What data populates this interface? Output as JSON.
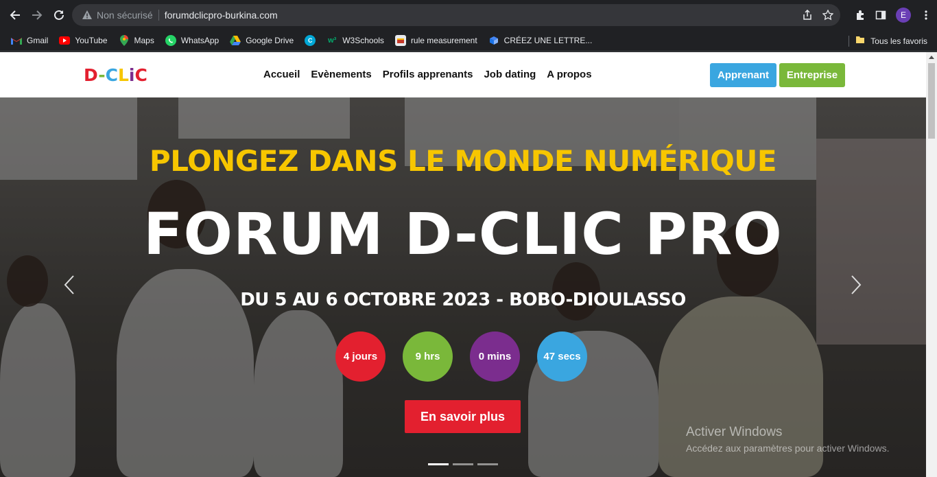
{
  "browser": {
    "security_label": "Non sécurisé",
    "url": "forumdclicpro-burkina.com",
    "profile_initial": "E"
  },
  "bookmarks": {
    "items": [
      {
        "label": "Gmail",
        "icon": "gmail-icon",
        "color": "#ea4335"
      },
      {
        "label": "YouTube",
        "icon": "youtube-icon",
        "color": "#ff0000"
      },
      {
        "label": "Maps",
        "icon": "maps-icon",
        "color": "#34a853"
      },
      {
        "label": "WhatsApp",
        "icon": "whatsapp-icon",
        "color": "#25d366"
      },
      {
        "label": "Google Drive",
        "icon": "google-drive-icon",
        "color": "#fbbc04"
      },
      {
        "label": "",
        "icon": "canva-icon",
        "color": "#00c4cc"
      },
      {
        "label": "W3Schools",
        "icon": "w3schools-icon",
        "color": "#04aa6d"
      },
      {
        "label": "rule measurement",
        "icon": "rule-measurement-icon",
        "color": "#e8eaed"
      },
      {
        "label": "CRÉEZ UNE LETTRE...",
        "icon": "letter-icon",
        "color": "#4285f4"
      }
    ],
    "all_favorites": "Tous les favoris"
  },
  "site": {
    "logo_letters": [
      "D",
      "-",
      "C",
      "L",
      "i",
      "C"
    ],
    "logo_colors": [
      "#e3202f",
      "#7ab83a",
      "#3aa6e0",
      "#f7c600",
      "#7b2d8e",
      "#e3202f"
    ],
    "menu": [
      "Accueil",
      "Evènements",
      "Profils apprenants",
      "Job dating",
      "A propos"
    ],
    "btn_apprenant": "Apprenant",
    "btn_entreprise": "Entreprise"
  },
  "hero": {
    "subtitle": "PLONGEZ DANS LE MONDE NUMÉRIQUE",
    "title": "FORUM D-CLIC PRO",
    "date": "DU 5 AU 6 OCTOBRE 2023 - BOBO-DIOULASSO",
    "countdown": [
      {
        "label": "4 jours",
        "color": "#e3202f"
      },
      {
        "label": "9 hrs",
        "color": "#7ab83a"
      },
      {
        "label": "0 mins",
        "color": "#7b2d8e"
      },
      {
        "label": "47 secs",
        "color": "#3aa6e0"
      }
    ],
    "cta": "En savoir plus",
    "slides": 3,
    "active_slide": 0
  },
  "windows_watermark": {
    "line1": "Activer Windows",
    "line2": "Accédez aux paramètres pour activer Windows."
  }
}
